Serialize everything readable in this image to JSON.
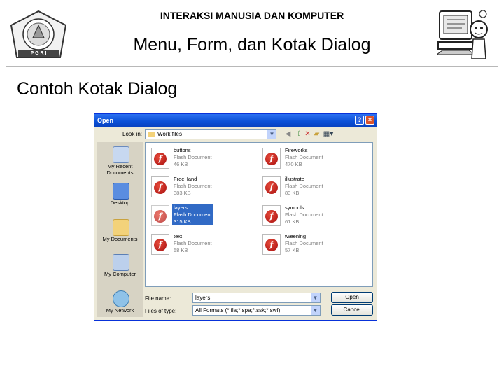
{
  "slide": {
    "course_title": "INTERAKSI MANUSIA DAN KOMPUTER",
    "title": "Menu, Form, dan Kotak Dialog",
    "section_title": "Contoh Kotak Dialog",
    "logo_text": "P G R I"
  },
  "dialog": {
    "title": "Open",
    "help_label": "?",
    "close_label": "×",
    "look_in_label": "Look in:",
    "look_in_value": "Work files",
    "places": [
      {
        "label": "My Recent Documents",
        "icon": "recent-documents-icon"
      },
      {
        "label": "Desktop",
        "icon": "desktop-icon"
      },
      {
        "label": "My Documents",
        "icon": "my-documents-icon"
      },
      {
        "label": "My Computer",
        "icon": "my-computer-icon"
      },
      {
        "label": "My Network",
        "icon": "my-network-icon"
      }
    ],
    "files": [
      {
        "name": "buttons",
        "type": "Flash Document",
        "size": "46 KB",
        "selected": false
      },
      {
        "name": "Fireworks",
        "type": "Flash Document",
        "size": "470 KB",
        "selected": false
      },
      {
        "name": "FreeHand",
        "type": "Flash Document",
        "size": "383 KB",
        "selected": false
      },
      {
        "name": "illustrate",
        "type": "Flash Document",
        "size": "83 KB",
        "selected": false
      },
      {
        "name": "layers",
        "type": "Flash Document",
        "size": "315 KB",
        "selected": true
      },
      {
        "name": "symbols",
        "type": "Flash Document",
        "size": "61 KB",
        "selected": false
      },
      {
        "name": "text",
        "type": "Flash Document",
        "size": "58 KB",
        "selected": false
      },
      {
        "name": "tweening",
        "type": "Flash Document",
        "size": "57 KB",
        "selected": false
      }
    ],
    "file_name_label": "File name:",
    "file_name_value": "layers",
    "file_type_label": "Files of type:",
    "file_type_value": "All Formats (*.fla;*.spa;*.ssk;*.swf)",
    "open_label": "Open",
    "cancel_label": "Cancel",
    "colors": {
      "titlebar": "#0a4fd6",
      "selection": "#316ac5",
      "dialog_bg": "#ece9d8"
    }
  }
}
